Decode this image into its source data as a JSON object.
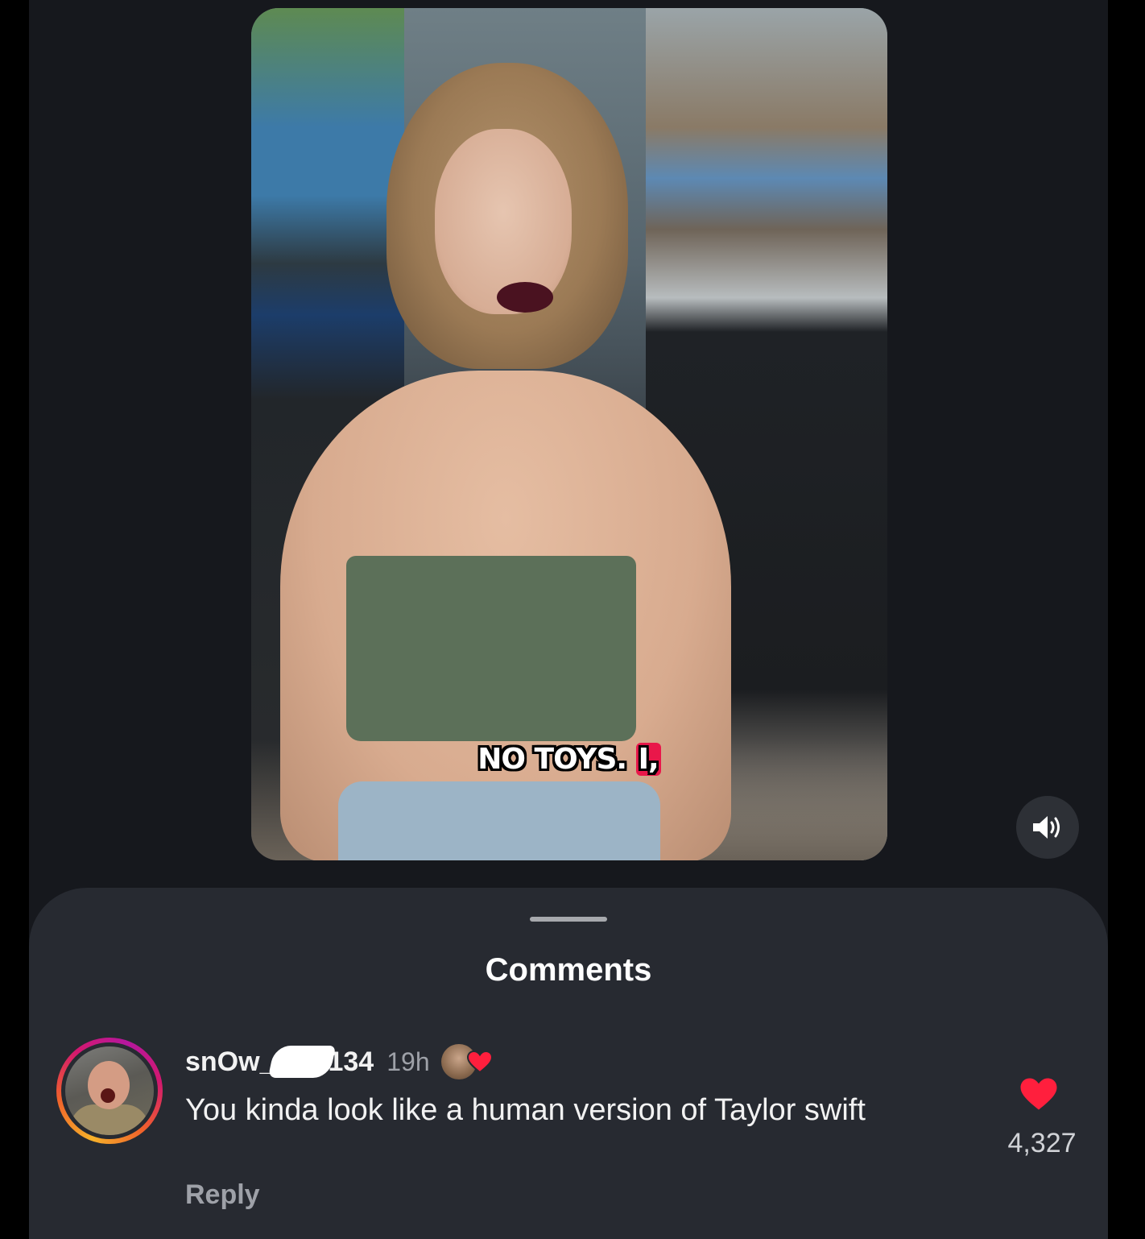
{
  "video": {
    "caption_text": "NO TOYS. ",
    "caption_highlight": "I,"
  },
  "controls": {
    "sound_icon": "speaker-on-icon"
  },
  "sheet": {
    "title": "Comments"
  },
  "comment": {
    "username_prefix": "snOw_",
    "username_suffix": "134",
    "time": "19h",
    "text": "You kinda look like a human version of Taylor swift",
    "reply_label": "Reply",
    "like_count": "4,327",
    "liked_by_creator": true
  },
  "colors": {
    "background": "#16181d",
    "sheet": "#272a31",
    "like_red": "#ff1f3d",
    "caption_highlight": "#e9174a"
  }
}
